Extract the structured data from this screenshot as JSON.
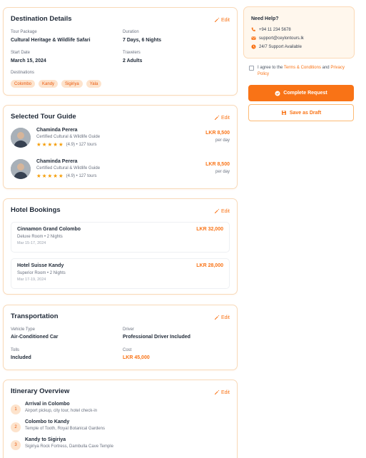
{
  "destination": {
    "title": "Destination Details",
    "edit": "Edit",
    "package_label": "Tour Package",
    "package_value": "Cultural Heritage & Wildlife Safari",
    "duration_label": "Duration",
    "duration_value": "7 Days, 6 Nights",
    "start_label": "Start Date",
    "start_value": "March 15, 2024",
    "travelers_label": "Travelers",
    "travelers_value": "2 Adults",
    "destinations_label": "Destinations",
    "chips": [
      "Colombo",
      "Kandy",
      "Sigiriya",
      "Yala"
    ]
  },
  "guides": {
    "title": "Selected Tour Guide",
    "edit": "Edit",
    "items": [
      {
        "name": "Chaminda Perera",
        "desc": "Certified Cultural & Wildlife Guide",
        "rating": "(4.9) • 127 tours",
        "stars": 5,
        "price": "LKR 8,500",
        "unit": "per day"
      },
      {
        "name": "Chaminda Perera",
        "desc": "Certified Cultural & Wildlife Guide",
        "rating": "(4.9) • 127 tours",
        "stars": 5,
        "price": "LKR 8,500",
        "unit": "per day"
      }
    ]
  },
  "hotels": {
    "title": "Hotel Bookings",
    "edit": "Edit",
    "items": [
      {
        "name": "Cinnamon Grand Colombo",
        "room": "Deluxe Room • 2 Nights",
        "dates": "Mar 15-17, 2024",
        "price": "LKR 32,000"
      },
      {
        "name": "Hotel Suisse Kandy",
        "room": "Superior Room • 2 Nights",
        "dates": "Mar 17-19, 2024",
        "price": "LKR 28,000"
      }
    ]
  },
  "transport": {
    "title": "Transportation",
    "edit": "Edit",
    "vehicle_label": "Vehicle Type",
    "vehicle_value": "Air-Conditioned Car",
    "driver_label": "Driver",
    "driver_value": "Professional Driver Included",
    "tolls_label": "Tolls",
    "tolls_value": "Included",
    "cost_label": "Cost",
    "cost_value": "LKR 45,000"
  },
  "itinerary": {
    "title": "Itinerary Overview",
    "edit": "Edit",
    "steps": [
      {
        "num": "1",
        "title": "Arrival in Colombo",
        "desc": "Airport pickup, city tour, hotel check-in"
      },
      {
        "num": "2",
        "title": "Colombo to Kandy",
        "desc": "Temple of Tooth, Royal Botanical Gardens"
      },
      {
        "num": "3",
        "title": "Kandy to Sigiriya",
        "desc": "Sigiriya Rock Fortress, Dambulla Cave Temple"
      }
    ]
  },
  "help": {
    "title": "Need Help?",
    "phone": "+94 11 234 5678",
    "email": "support@ceylontours.lk",
    "support": "24/7 Support Available"
  },
  "agree": {
    "prefix": "I agree to the ",
    "terms": "Terms & Conditions",
    "and": " and ",
    "privacy": "Privacy Policy"
  },
  "actions": {
    "complete": "Complete Request",
    "draft": "Save as Draft"
  },
  "colors": {
    "accent": "#f97316",
    "chip_bg": "#fde3cc",
    "star": "#f59e0b"
  }
}
